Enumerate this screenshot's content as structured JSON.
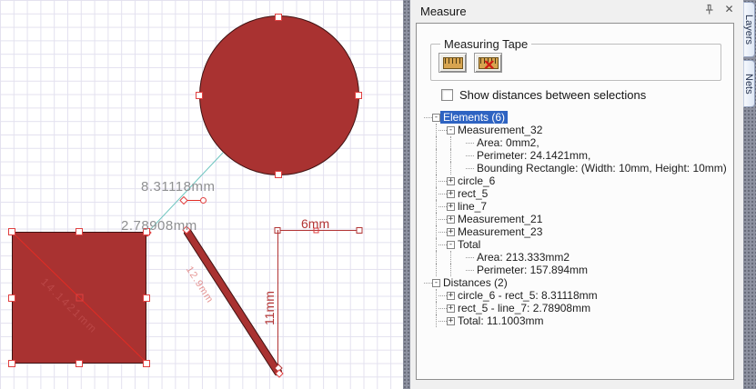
{
  "panel": {
    "title": "Measure",
    "window_buttons": {
      "pin": "pin-icon",
      "close": "×"
    },
    "measuring_tape": {
      "label": "Measuring Tape",
      "buttons": [
        {
          "name": "measuring-tape-button",
          "icon": "ruler-icon"
        },
        {
          "name": "measuring-tape-off-button",
          "icon": "ruler-crossed-icon"
        }
      ]
    },
    "checkbox": {
      "label": "Show distances between selections",
      "checked": false
    },
    "tree": [
      {
        "level": 0,
        "exp": "minus",
        "label": "Elements (6)",
        "selected": true
      },
      {
        "level": 1,
        "exp": "minus",
        "label": "Measurement_32"
      },
      {
        "level": 2,
        "exp": "none",
        "label": "Area: 0mm2,"
      },
      {
        "level": 2,
        "exp": "none",
        "label": "Perimeter: 24.1421mm,"
      },
      {
        "level": 2,
        "exp": "none",
        "label": "Bounding Rectangle: (Width: 10mm, Height: 10mm)"
      },
      {
        "level": 1,
        "exp": "plus",
        "label": "circle_6"
      },
      {
        "level": 1,
        "exp": "plus",
        "label": "rect_5"
      },
      {
        "level": 1,
        "exp": "plus",
        "label": "line_7"
      },
      {
        "level": 1,
        "exp": "plus",
        "label": "Measurement_21"
      },
      {
        "level": 1,
        "exp": "plus",
        "label": "Measurement_23"
      },
      {
        "level": 1,
        "exp": "minus",
        "label": "Total"
      },
      {
        "level": 2,
        "exp": "none",
        "label": "Area: 213.333mm2"
      },
      {
        "level": 2,
        "exp": "none",
        "label": "Perimeter: 157.894mm"
      },
      {
        "level": 0,
        "exp": "minus",
        "label": "Distances (2)"
      },
      {
        "level": 1,
        "exp": "plus",
        "label": "circle_6 - rect_5: 8.31118mm"
      },
      {
        "level": 1,
        "exp": "plus",
        "label": "rect_5 - line_7: 2.78908mm"
      },
      {
        "level": 1,
        "exp": "plus",
        "label": "Total: 11.1003mm"
      }
    ]
  },
  "side_tabs": [
    {
      "label": "Layers"
    },
    {
      "label": "Nets"
    }
  ],
  "canvas": {
    "labels": {
      "distance_circle_rect": "8.31118mm",
      "distance_rect_line": "2.78908mm",
      "dim_width": "6mm",
      "dim_height": "11mm",
      "diag_faint": "14.1421mm",
      "bar_faint": "12.9mm"
    },
    "colors": {
      "shape_fill": "#a93231",
      "measure_red": "#e04040",
      "dimension_red": "#b23434",
      "tape_teal": "#6fc6c0",
      "label_gray": "#8f9092",
      "grid": "#e3e1ef",
      "selection_blue": "#2e63c2"
    }
  }
}
